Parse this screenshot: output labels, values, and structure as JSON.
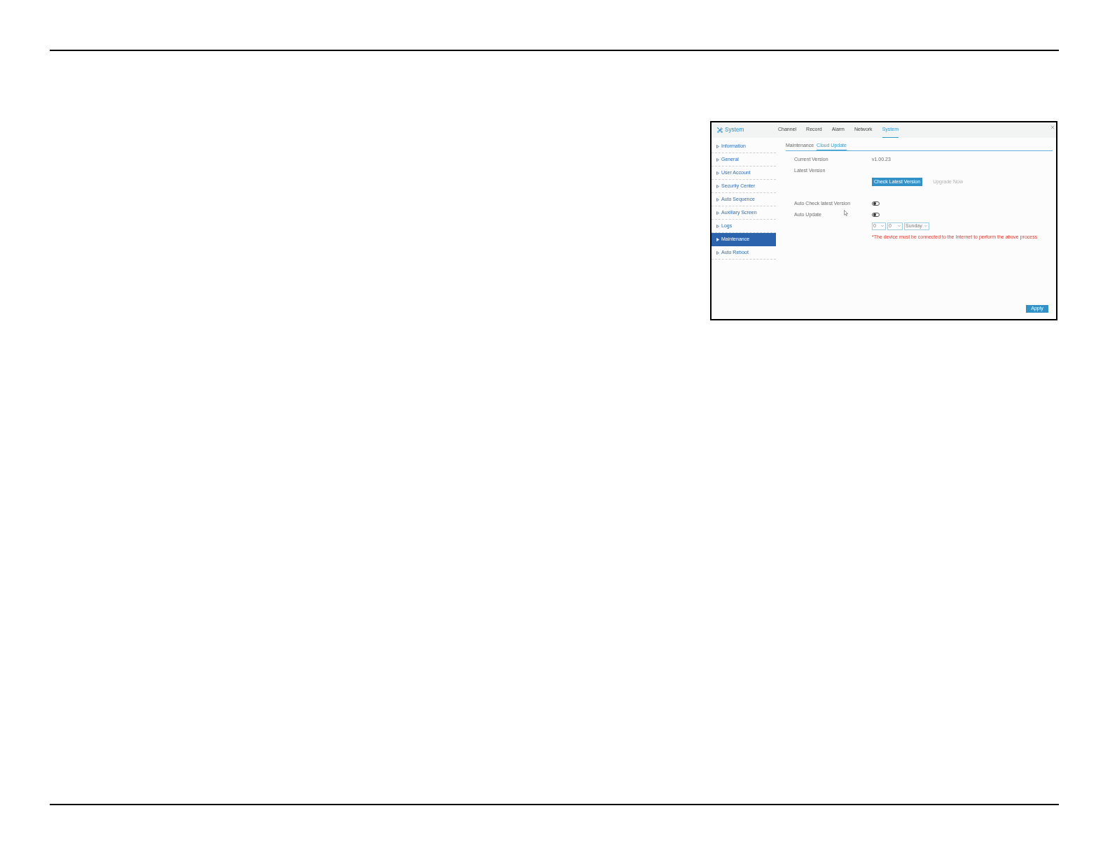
{
  "window": {
    "title": "System"
  },
  "tabs": [
    {
      "label": "Channel",
      "selected": false
    },
    {
      "label": "Record",
      "selected": false
    },
    {
      "label": "Alarm",
      "selected": false
    },
    {
      "label": "Network",
      "selected": false
    },
    {
      "label": "System",
      "selected": true
    }
  ],
  "sidebar": {
    "items": [
      {
        "label": "Information",
        "selected": false
      },
      {
        "label": "General",
        "selected": false
      },
      {
        "label": "User Account",
        "selected": false
      },
      {
        "label": "Security Center",
        "selected": false
      },
      {
        "label": "Auto Sequence",
        "selected": false
      },
      {
        "label": "Auxiliary Screen",
        "selected": false
      },
      {
        "label": "Logs",
        "selected": false
      },
      {
        "label": "Maintenance",
        "selected": true
      },
      {
        "label": "Auto Reboot",
        "selected": false
      }
    ]
  },
  "subtabs": [
    {
      "label": "Maintenance",
      "selected": false
    },
    {
      "label": "Cloud Update",
      "selected": true
    }
  ],
  "form": {
    "rows": [
      {
        "kind": "value",
        "label": "Current Version",
        "value": "v1.00.23"
      },
      {
        "kind": "value",
        "label": "Latest Version"
      },
      {
        "kind": "buttons",
        "buttons": [
          {
            "label": "Check Latest Version",
            "disabled": false
          },
          {
            "label": "Upgrade Now",
            "disabled": true
          }
        ]
      },
      {
        "kind": "toggle",
        "label": "Auto Check latest Version",
        "on": false
      },
      {
        "kind": "toggle",
        "label": "Auto Update",
        "on": false
      },
      {
        "kind": "selects",
        "selects": [
          {
            "value": "0"
          },
          {
            "value": "0"
          },
          {
            "value": "Sunday"
          }
        ]
      },
      {
        "kind": "note",
        "text": "*The device must be connected to the Internet to perform the above process"
      }
    ]
  },
  "footer": {
    "buttons": [
      "Apply"
    ]
  }
}
